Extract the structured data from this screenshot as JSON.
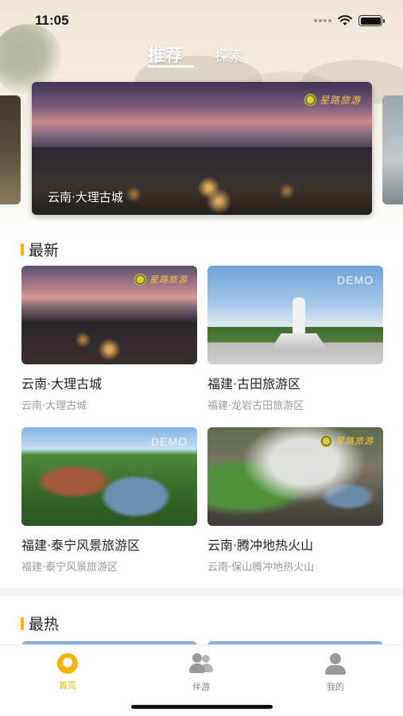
{
  "status_bar": {
    "time": "11:05"
  },
  "top_tabs": {
    "recommend": "推荐",
    "explore": "探索"
  },
  "carousel": {
    "logo_text": "星路旅游",
    "caption": "云南·大理古城"
  },
  "sections": {
    "latest": "最新",
    "hottest": "最热"
  },
  "latest_cards": [
    {
      "title": "云南·大理古城",
      "subtitle": "云南·大理古城",
      "badge": "星路旅游"
    },
    {
      "title": "福建·古田旅游区",
      "subtitle": "福建·龙岩古田旅游区",
      "badge": "DEMO"
    },
    {
      "title": "福建·泰宁风景旅游区",
      "subtitle": "福建·泰宁风景旅游区",
      "badge": "DEMO"
    },
    {
      "title": "云南·腾冲地热火山",
      "subtitle": "云南·保山腾冲地热火山",
      "badge": "星路旅游"
    }
  ],
  "tab_bar": {
    "items": [
      {
        "label": "首页",
        "icon": "home-icon",
        "active": true
      },
      {
        "label": "伴游",
        "icon": "companions-icon",
        "active": false
      },
      {
        "label": "我的",
        "icon": "profile-icon",
        "active": false
      }
    ]
  },
  "colors": {
    "accent": "#f6b400",
    "muted_text": "#999999"
  }
}
